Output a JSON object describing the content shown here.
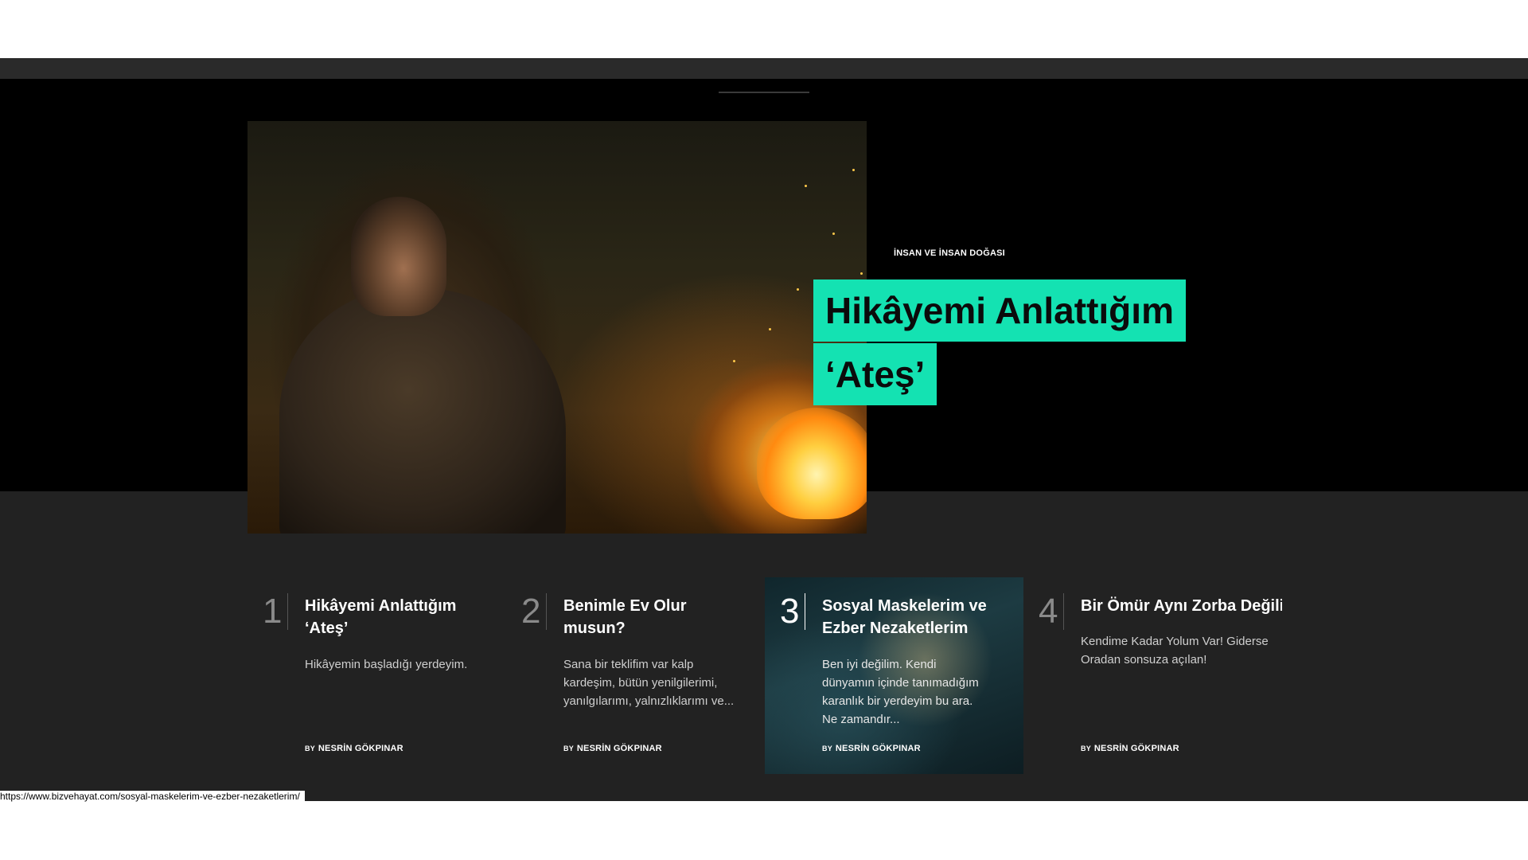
{
  "hero": {
    "category": "İNSAN VE İNSAN DOĞASI",
    "title_line_1": "Hikâyemi Anlattığım",
    "title_line_2": "‘Ateş’",
    "accent_color": "#14e2b2"
  },
  "cards": [
    {
      "number": "1",
      "title": "Hikâyemi Anlattığım\n‘Ateş’",
      "excerpt": "Hikâyemin başladığı yerdeyim.",
      "by_label": "BY",
      "author": "NESRİN GÖKPINAR"
    },
    {
      "number": "2",
      "title": "Benimle Ev Olur\nmusun?",
      "excerpt": "Sana bir teklifim var kalp\nkardeşim, bütün yenilgilerimi,\nyanılgılarımı, yalnızlıklarımı ve...",
      "by_label": "BY",
      "author": "NESRİN GÖKPINAR"
    },
    {
      "number": "3",
      "title": "Sosyal Maskelerim ve\nEzber Nezaketlerim",
      "excerpt": "Ben iyi değilim. Kendi\ndünyamın içinde tanımadığım\nkaranlık bir yerdeyim bu ara.\nNe zamandır...",
      "by_label": "BY",
      "author": "NESRİN GÖKPINAR"
    },
    {
      "number": "4",
      "title": "Bir Ömür Aynı Zorba Değili",
      "excerpt": "Kendime Kadar Yolum Var! Giderse\nOradan sonsuza açılan!",
      "by_label": "BY",
      "author": "NESRİN GÖKPINAR"
    }
  ],
  "status_bar": {
    "url": "https://www.bizvehayat.com/sosyal-maskelerim-ve-ezber-nezaketlerim/"
  }
}
